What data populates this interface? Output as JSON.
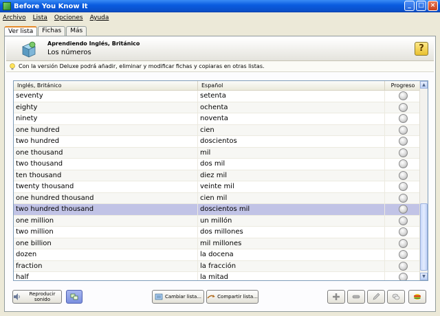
{
  "window": {
    "title": "Before You Know It"
  },
  "menu": [
    "Archivo",
    "Lista",
    "Opciones",
    "Ayuda"
  ],
  "tabs": [
    "Ver lista",
    "Fichas",
    "Más"
  ],
  "header": {
    "subtitle": "Aprendiendo Inglés, Británico",
    "title": "Los números",
    "help": "?"
  },
  "notice": "Con la versión Deluxe podrá añadir, eliminar y modificar fichas y copiaras en otras listas.",
  "table": {
    "columns": [
      "Inglés, Británico",
      "Español",
      "Progreso"
    ],
    "rows": [
      [
        "seventy",
        "setenta"
      ],
      [
        "eighty",
        "ochenta"
      ],
      [
        "ninety",
        "noventa"
      ],
      [
        "one hundred",
        "cien"
      ],
      [
        "two hundred",
        "doscientos"
      ],
      [
        "one thousand",
        "mil"
      ],
      [
        "two thousand",
        "dos mil"
      ],
      [
        "ten thousand",
        "diez mil"
      ],
      [
        "twenty thousand",
        "veinte mil"
      ],
      [
        "one hundred thousand",
        "cien mil"
      ],
      [
        "two hundred thousand",
        "doscientos mil"
      ],
      [
        "one million",
        "un millón"
      ],
      [
        "two million",
        "dos millones"
      ],
      [
        "one billion",
        "mil millones"
      ],
      [
        "dozen",
        "la docena"
      ],
      [
        "fraction",
        "la fracción"
      ],
      [
        "half",
        "la mitad"
      ]
    ],
    "selected_row": 10
  },
  "buttons": {
    "play": "Reproducir sonido",
    "change_list": "Cambiar lista...",
    "share_list": "Compartir lista..."
  },
  "icons": {
    "app": "app-icon",
    "help": "help-icon",
    "bulb": "lightbulb-icon",
    "play": "speaker-icon",
    "shuffle": "shuffle-icon",
    "change": "list-icon",
    "share": "share-icon",
    "add": "plus-icon",
    "remove": "minus-icon",
    "edit": "pencil-icon",
    "comment": "comment-icon",
    "flag": "flag-icon"
  },
  "colors": {
    "titlebar": "#0a5ce0",
    "selected_row": "#c1c3e6",
    "accent_tab": "#e68b2c"
  }
}
